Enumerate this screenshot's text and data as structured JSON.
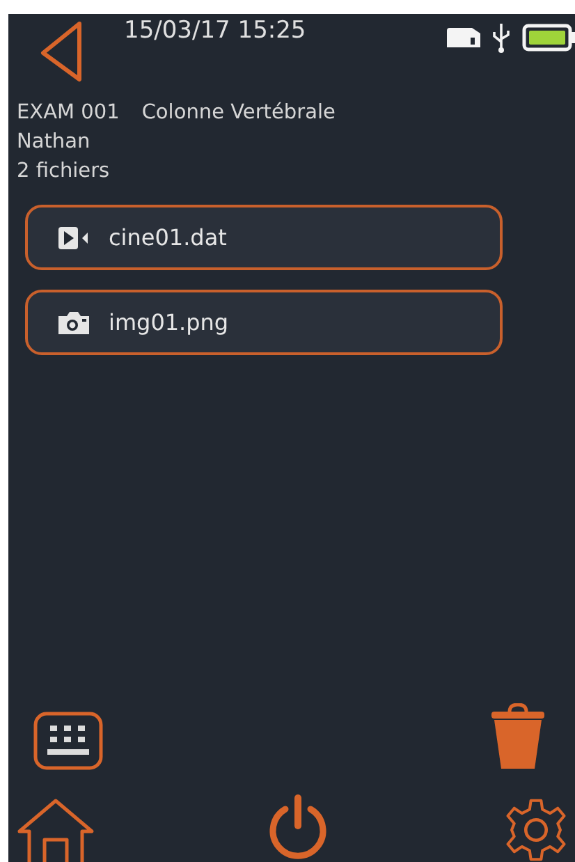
{
  "status_bar": {
    "datetime": "15/03/17 15:25"
  },
  "exam": {
    "id": "EXAM 001",
    "region": "Colonne Vertébrale",
    "patient": "Nathan",
    "file_count": "2 fichiers"
  },
  "files": [
    {
      "kind": "video",
      "name": "cine01.dat"
    },
    {
      "kind": "image",
      "name": "img01.png"
    }
  ]
}
